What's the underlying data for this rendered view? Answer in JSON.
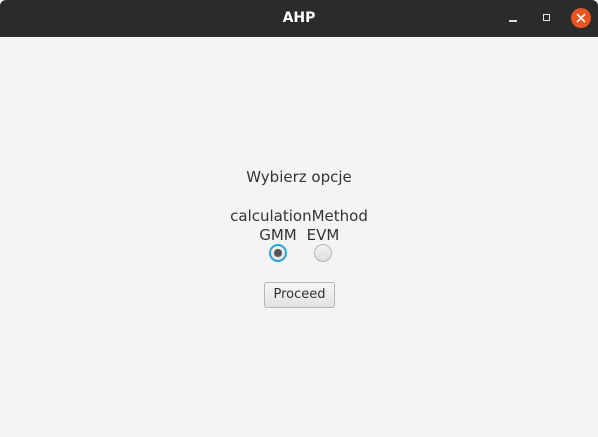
{
  "window": {
    "title": "AHP",
    "controls": {
      "minimize_icon": "minimize-icon",
      "maximize_icon": "maximize-icon",
      "close_icon": "close-icon"
    },
    "close_color": "#e95420",
    "titlebar_color": "#2b2b2b"
  },
  "main": {
    "heading": "Wybierz opcje",
    "group_label": "calculationMethod",
    "options": [
      {
        "label": "GMM",
        "selected": true
      },
      {
        "label": "EVM",
        "selected": false
      }
    ],
    "proceed_label": "Proceed"
  },
  "colors": {
    "background": "#f4f4f4",
    "focus_ring": "#2aa3d8",
    "text": "#333333"
  }
}
